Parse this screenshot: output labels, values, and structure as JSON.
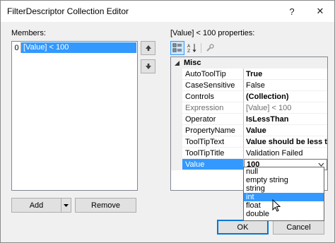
{
  "window": {
    "title": "FilterDescriptor Collection Editor",
    "help_glyph": "?",
    "close_glyph": "✕"
  },
  "members": {
    "label": "Members:",
    "items": [
      {
        "index": "0",
        "text": "[Value] < 100",
        "selected": true
      }
    ],
    "up_icon": "arrow-up-icon",
    "down_icon": "arrow-down-icon"
  },
  "buttons": {
    "add": "Add",
    "remove": "Remove",
    "ok": "OK",
    "cancel": "Cancel"
  },
  "properties": {
    "label": "[Value] < 100 properties:",
    "toolbar": [
      "categorized-icon",
      "alphabetical-icon",
      "property-pages-icon"
    ],
    "category": "Misc",
    "rows": [
      {
        "name": "AutoToolTip",
        "value": "True",
        "bold": true,
        "dim": false
      },
      {
        "name": "CaseSensitive",
        "value": "False",
        "bold": false,
        "dim": false
      },
      {
        "name": "Controls",
        "value": "(Collection)",
        "bold": true,
        "dim": false
      },
      {
        "name": "Expression",
        "value": "[Value] < 100",
        "bold": false,
        "dim": true
      },
      {
        "name": "Operator",
        "value": "IsLessThan",
        "bold": true,
        "dim": false
      },
      {
        "name": "PropertyName",
        "value": "Value",
        "bold": true,
        "dim": false
      },
      {
        "name": "ToolTipText",
        "value": "Value should be less than",
        "bold": true,
        "dim": false
      },
      {
        "name": "ToolTipTitle",
        "value": "Validation Failed",
        "bold": false,
        "dim": false
      },
      {
        "name": "Value",
        "value": "100",
        "bold": true,
        "dim": false,
        "selected": true
      }
    ]
  },
  "dropdown": {
    "options": [
      "null",
      "empty string",
      "string",
      "int",
      "float",
      "double"
    ],
    "selected": "int"
  },
  "colors": {
    "selection": "#3399ff",
    "accent": "#0078d7"
  }
}
